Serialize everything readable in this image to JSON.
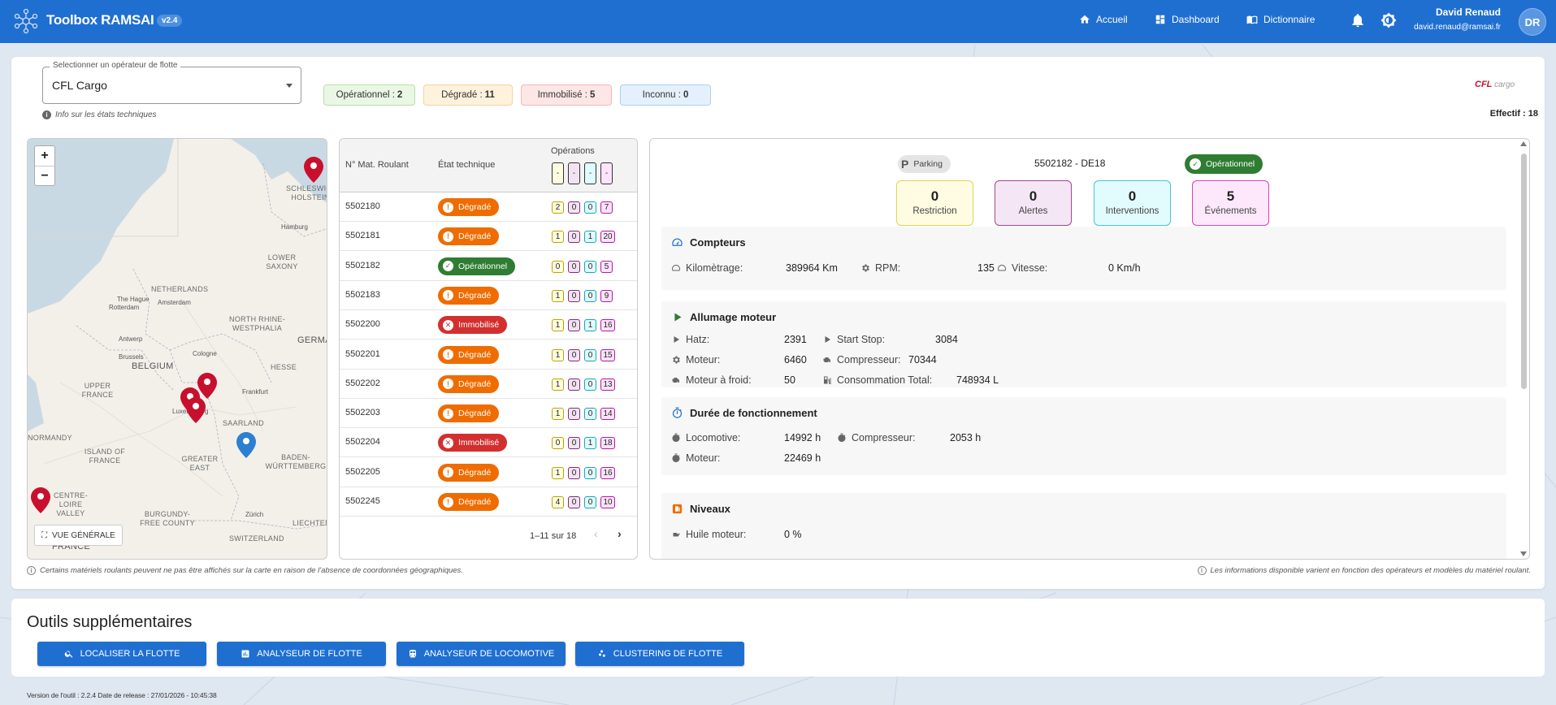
{
  "app": {
    "title": "Toolbox RAMSAI",
    "version": "v2.4"
  },
  "nav": {
    "home": "Accueil",
    "dashboard": "Dashboard",
    "dictionary": "Dictionnaire"
  },
  "user": {
    "name": "David Renaud",
    "email": "david.renaud@ramsai.fr",
    "initials": "DR"
  },
  "operator_select": {
    "label": "Selectionner un opérateur de flotte",
    "value": "CFL Cargo"
  },
  "info_link": "Info sur les états techniques",
  "status_counts": [
    {
      "label": "Opérationnel :",
      "count": "2"
    },
    {
      "label": "Dégradé :",
      "count": "11"
    },
    {
      "label": "Immobilisé :",
      "count": "5"
    },
    {
      "label": "Inconnu :",
      "count": "0"
    }
  ],
  "brand": {
    "mark": "CFL",
    "text": "cargo"
  },
  "effectif": "Effectif : 18",
  "map": {
    "zoom_in": "+",
    "zoom_out": "−",
    "overview_button": "VUE GÉNÉRALE",
    "labels": [
      "SCHLESWIG-HOLSTEIN",
      "Hamburg",
      "LOWER SAXONY",
      "NETHERLANDS",
      "The Hague",
      "Rotterdam",
      "Amsterdam",
      "NORTH RHINE-WESTPHALIA",
      "Antwerp",
      "Cologne",
      "GERMANY",
      "Brussels",
      "BELGIUM",
      "HESSE",
      "UPPER FRANCE",
      "Frankfurt",
      "Luxembourg",
      "SAARLAND",
      "ISLAND OF FRANCE",
      "GREATER EAST",
      "BADEN-WÜRTTEMBERG",
      "NORMANDY",
      "CENTRE-LOIRE VALLEY",
      "BURGUNDY-FREE COUNTY",
      "Zürich",
      "LIECHTENSTEIN",
      "SWITZERLAND",
      "FRANCE"
    ]
  },
  "table": {
    "col_mat": "N° Mat. Roulant",
    "col_state": "État technique",
    "col_ops": "Opérations",
    "ops_header": [
      "-",
      "-",
      "-",
      "-"
    ],
    "rows": [
      {
        "mat": "5502180",
        "state": "Dégradé",
        "kind": "degrade",
        "ops": [
          "2",
          "0",
          "0",
          "7"
        ]
      },
      {
        "mat": "5502181",
        "state": "Dégradé",
        "kind": "degrade",
        "ops": [
          "1",
          "0",
          "1",
          "20"
        ]
      },
      {
        "mat": "5502182",
        "state": "Opérationnel",
        "kind": "op",
        "ops": [
          "0",
          "0",
          "0",
          "5"
        ]
      },
      {
        "mat": "5502183",
        "state": "Dégradé",
        "kind": "degrade",
        "ops": [
          "1",
          "0",
          "0",
          "9"
        ]
      },
      {
        "mat": "5502200",
        "state": "Immobilisé",
        "kind": "imm",
        "ops": [
          "1",
          "0",
          "1",
          "16"
        ]
      },
      {
        "mat": "5502201",
        "state": "Dégradé",
        "kind": "degrade",
        "ops": [
          "1",
          "0",
          "0",
          "15"
        ]
      },
      {
        "mat": "5502202",
        "state": "Dégradé",
        "kind": "degrade",
        "ops": [
          "1",
          "0",
          "0",
          "13"
        ]
      },
      {
        "mat": "5502203",
        "state": "Dégradé",
        "kind": "degrade",
        "ops": [
          "1",
          "0",
          "0",
          "14"
        ]
      },
      {
        "mat": "5502204",
        "state": "Immobilisé",
        "kind": "imm",
        "ops": [
          "0",
          "0",
          "1",
          "18"
        ]
      },
      {
        "mat": "5502205",
        "state": "Dégradé",
        "kind": "degrade",
        "ops": [
          "1",
          "0",
          "0",
          "16"
        ]
      },
      {
        "mat": "5502245",
        "state": "Dégradé",
        "kind": "degrade",
        "ops": [
          "4",
          "0",
          "0",
          "10"
        ]
      }
    ],
    "pagination": "1–11 sur 18"
  },
  "detail": {
    "location": "Parking",
    "title": "5502182 - DE18",
    "state": "Opérationnel",
    "stats": [
      {
        "value": "0",
        "label": "Restriction"
      },
      {
        "value": "0",
        "label": "Alertes"
      },
      {
        "value": "0",
        "label": "Interventions"
      },
      {
        "value": "5",
        "label": "Événements"
      }
    ],
    "compteurs": {
      "title": "Compteurs",
      "km_label": "Kilomètrage:",
      "km_value": "389964 Km",
      "rpm_label": "RPM:",
      "rpm_value": "135",
      "speed_label": "Vitesse:",
      "speed_value": "0 Km/h"
    },
    "allumage": {
      "title": "Allumage moteur",
      "hatz_label": "Hatz:",
      "hatz_value": "2391",
      "startstop_label": "Start Stop:",
      "startstop_value": "3084",
      "moteur_label": "Moteur:",
      "moteur_value": "6460",
      "compresseur_label": "Compresseur:",
      "compresseur_value": "70344",
      "froid_label": "Moteur à froid:",
      "froid_value": "50",
      "conso_label": "Consommation Total:",
      "conso_value": "748934 L"
    },
    "duree": {
      "title": "Durée de fonctionnement",
      "loco_label": "Locomotive:",
      "loco_value": "14992 h",
      "compresseur_label": "Compresseur:",
      "compresseur_value": "2053 h",
      "moteur_label": "Moteur:",
      "moteur_value": "22469 h"
    },
    "niveaux": {
      "title": "Niveaux",
      "huile_label": "Huile moteur:",
      "huile_value": "0 %"
    }
  },
  "footnotes": {
    "left": "Certains matériels roulants peuvent ne pas être affichés sur la carte en raison de l'absence de coordonnées géographiques.",
    "right": "Les informations disponible varient en fonction des opérateurs et modèles du matériel roulant."
  },
  "tools": {
    "title": "Outils supplémentaires",
    "buttons": [
      "LOCALISER LA FLOTTE",
      "ANALYSEUR DE FLOTTE",
      "ANALYSEUR DE LOCOMOTIVE",
      "CLUSTERING DE FLOTTE"
    ]
  },
  "version_line": "Version de l'outil : 2.2.4    Date de release : 27/01/2026 - 10:45:38",
  "colors": {
    "primary": "#1f6fd1",
    "degrade": "#ef6c00",
    "operational": "#2e7d32",
    "immobilise": "#d32f2f"
  }
}
